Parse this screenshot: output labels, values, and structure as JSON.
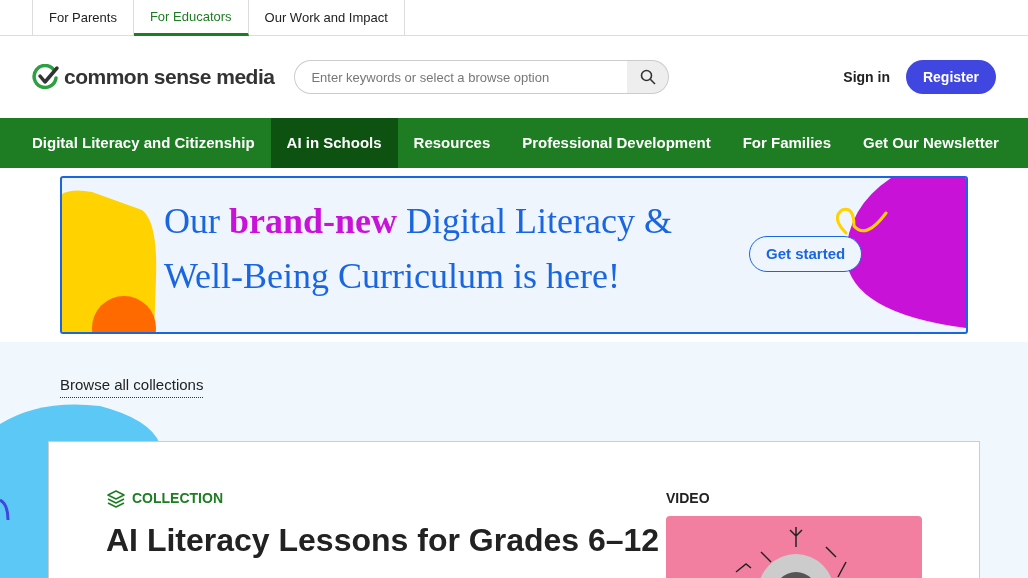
{
  "top_tabs": [
    {
      "label": "For Parents",
      "selected": false
    },
    {
      "label": "For Educators",
      "selected": true
    },
    {
      "label": "Our Work and Impact",
      "selected": false
    }
  ],
  "header": {
    "logo": "common sense media",
    "search": {
      "placeholder": "Enter keywords or select a browse option"
    },
    "sign_in": "Sign in",
    "register": "Register"
  },
  "main_nav": [
    {
      "label": "Digital Literacy and Citizenship",
      "selected": false
    },
    {
      "label": "AI in Schools",
      "selected": true
    },
    {
      "label": "Resources",
      "selected": false
    },
    {
      "label": "Professional Development",
      "selected": false
    },
    {
      "label": "For Families",
      "selected": false
    },
    {
      "label": "Get Our Newsletter",
      "selected": false
    }
  ],
  "banner": {
    "title": "Our **brand-new** Digital Literacy & Well-Being Curriculum is here!",
    "button": "Get started"
  },
  "browse_link": "Browse all collections",
  "card": {
    "eyebrow": "COLLECTION",
    "title": "AI Literacy Lessons for Grades 6–12",
    "media_label": "VIDEO"
  }
}
